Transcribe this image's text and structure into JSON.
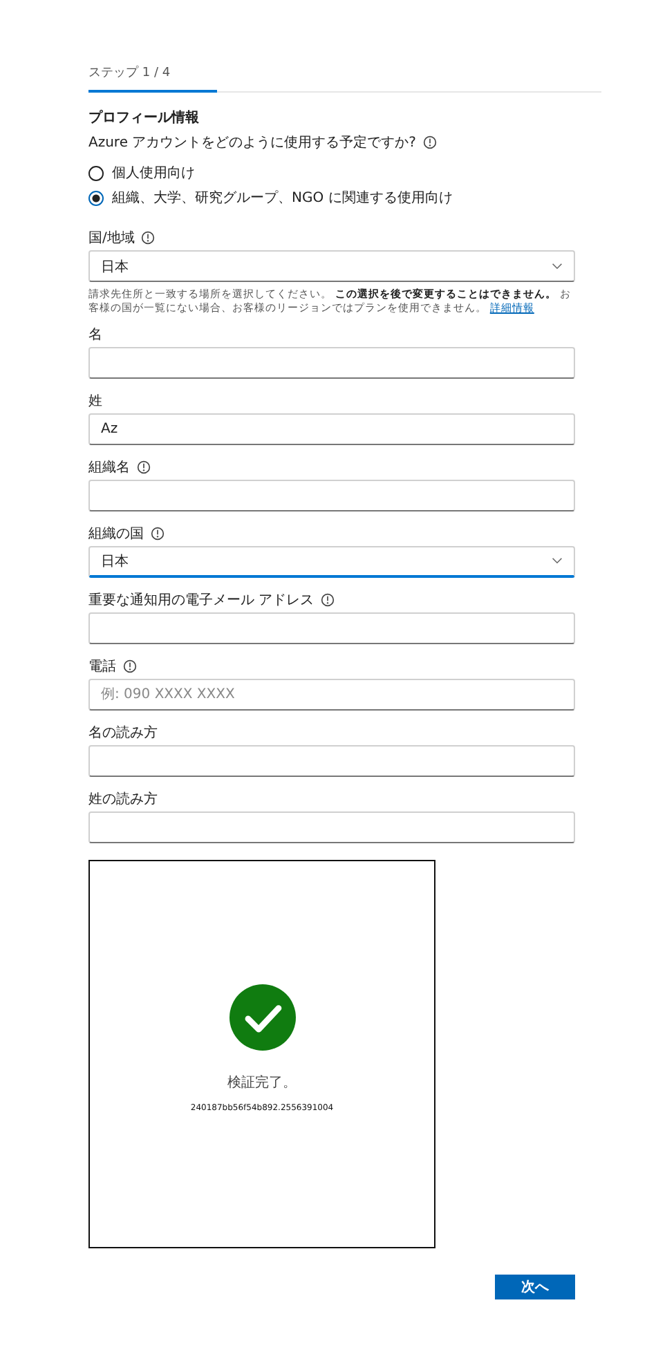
{
  "step_tab": {
    "label": "ステップ 1 / 4",
    "selected": true
  },
  "section_title": "プロフィール情報",
  "usage": {
    "question": "Azure アカウントをどのように使用する予定ですか?",
    "info": true,
    "options": [
      {
        "label": "個人使用向け",
        "selected": false
      },
      {
        "label": "組織、大学、研究グループ、NGO に関連する使用向け",
        "selected": true
      }
    ]
  },
  "fields": [
    {
      "kind": "select",
      "label": "国/地域",
      "info": true,
      "value": "日本",
      "focused": false,
      "help": "請求先住所と一致する場所を選択してください。 **この選択を後で変更することはできません。** お客様の国が一覧にない場合、お客様のリージョンではプランを使用できません。",
      "help_link": "詳細情報"
    },
    {
      "kind": "text",
      "label": "名",
      "info": false,
      "focused": false
    },
    {
      "kind": "text",
      "label": "姓",
      "info": false,
      "value": "Az",
      "focused": false
    },
    {
      "kind": "text",
      "label": "組織名",
      "info": true,
      "focused": false
    },
    {
      "kind": "select",
      "label": "組織の国",
      "info": true,
      "value": "日本",
      "focused": true
    },
    {
      "kind": "text",
      "label": "重要な通知用の電子メール アドレス",
      "info": true,
      "focused": false
    },
    {
      "kind": "text",
      "label": "電話",
      "info": true,
      "placeholder": "例: 090 XXXX XXXX",
      "focused": false
    },
    {
      "kind": "text",
      "label": "名の読み方",
      "info": false,
      "focused": false
    },
    {
      "kind": "text",
      "label": "姓の読み方",
      "info": false,
      "focused": false
    }
  ],
  "verification": {
    "status": "検証完了。",
    "code": "240187bb56f54b892.2556391004"
  },
  "next_button": "次へ"
}
